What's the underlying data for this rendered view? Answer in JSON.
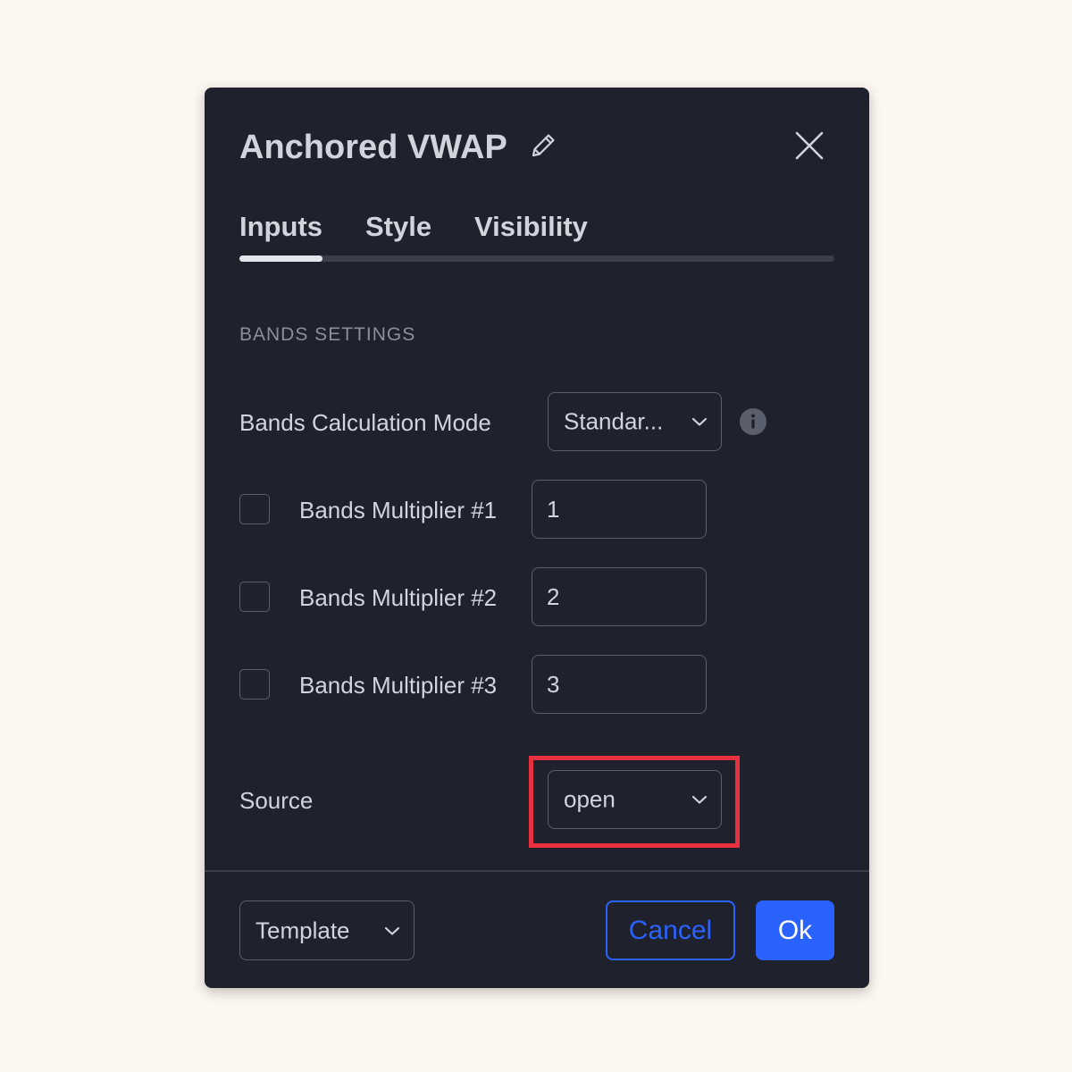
{
  "dialog": {
    "title": "Anchored VWAP",
    "tabs": [
      {
        "label": "Inputs",
        "active": true
      },
      {
        "label": "Style",
        "active": false
      },
      {
        "label": "Visibility",
        "active": false
      }
    ],
    "section_title": "BANDS SETTINGS",
    "calc_mode": {
      "label": "Bands Calculation Mode",
      "value": "Standar..."
    },
    "multipliers": [
      {
        "label": "Bands Multiplier #1",
        "value": "1",
        "checked": false
      },
      {
        "label": "Bands Multiplier #2",
        "value": "2",
        "checked": false
      },
      {
        "label": "Bands Multiplier #3",
        "value": "3",
        "checked": false
      }
    ],
    "source": {
      "label": "Source",
      "value": "open"
    },
    "footer": {
      "template_label": "Template",
      "cancel_label": "Cancel",
      "ok_label": "Ok"
    }
  },
  "colors": {
    "page_bg": "#fcf7f1",
    "dialog_bg": "#1f222c",
    "text": "#d1d4dc",
    "muted": "#8a8f9c",
    "accent": "#2962ff",
    "highlight": "#e8303f"
  },
  "icons": [
    "pencil-icon",
    "close-icon",
    "chevron-down-icon",
    "info-icon"
  ]
}
